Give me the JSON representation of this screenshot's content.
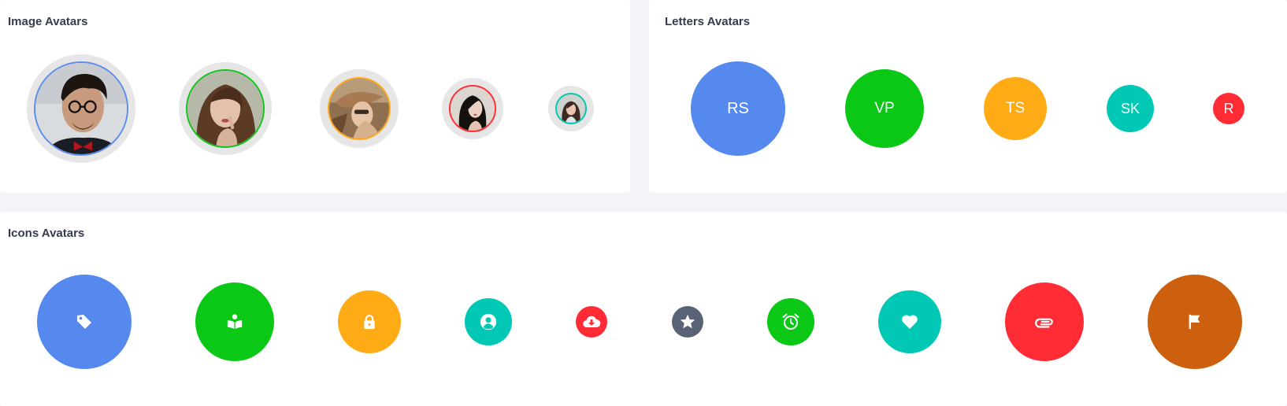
{
  "image_avatars": {
    "title": "Image Avatars",
    "items": [
      {
        "name": "avatar-man-glasses",
        "border": "#5b8def"
      },
      {
        "name": "avatar-woman-brown-hair",
        "border": "#10c41b"
      },
      {
        "name": "avatar-woman-hat",
        "border": "#ffa918"
      },
      {
        "name": "avatar-woman-dark-hair",
        "border": "#ff2f35"
      },
      {
        "name": "avatar-small-portrait",
        "border": "#00c7b1"
      }
    ]
  },
  "letter_avatars": {
    "title": "Letters Avatars",
    "items": [
      {
        "text": "RS",
        "color": "#5589ee"
      },
      {
        "text": "VP",
        "color": "#0bc716"
      },
      {
        "text": "TS",
        "color": "#ffab16"
      },
      {
        "text": "SK",
        "color": "#00c8b5"
      },
      {
        "text": "R",
        "color": "#ff2c35"
      }
    ]
  },
  "icon_avatars": {
    "title": "Icons Avatars",
    "items": [
      {
        "icon": "tag-icon",
        "color": "#5589ee"
      },
      {
        "icon": "book-reader-icon",
        "color": "#0bc716"
      },
      {
        "icon": "lock-icon",
        "color": "#ffab16"
      },
      {
        "icon": "user-circle-icon",
        "color": "#00c8b5"
      },
      {
        "icon": "cloud-download-icon",
        "color": "#ff2c35"
      },
      {
        "icon": "star-icon",
        "color": "#5a6376"
      },
      {
        "icon": "alarm-clock-icon",
        "color": "#0bc716"
      },
      {
        "icon": "heart-icon",
        "color": "#00c8b5"
      },
      {
        "icon": "paperclip-icon",
        "color": "#ff2c35"
      },
      {
        "icon": "flag-icon",
        "color": "#cc600e"
      }
    ]
  }
}
